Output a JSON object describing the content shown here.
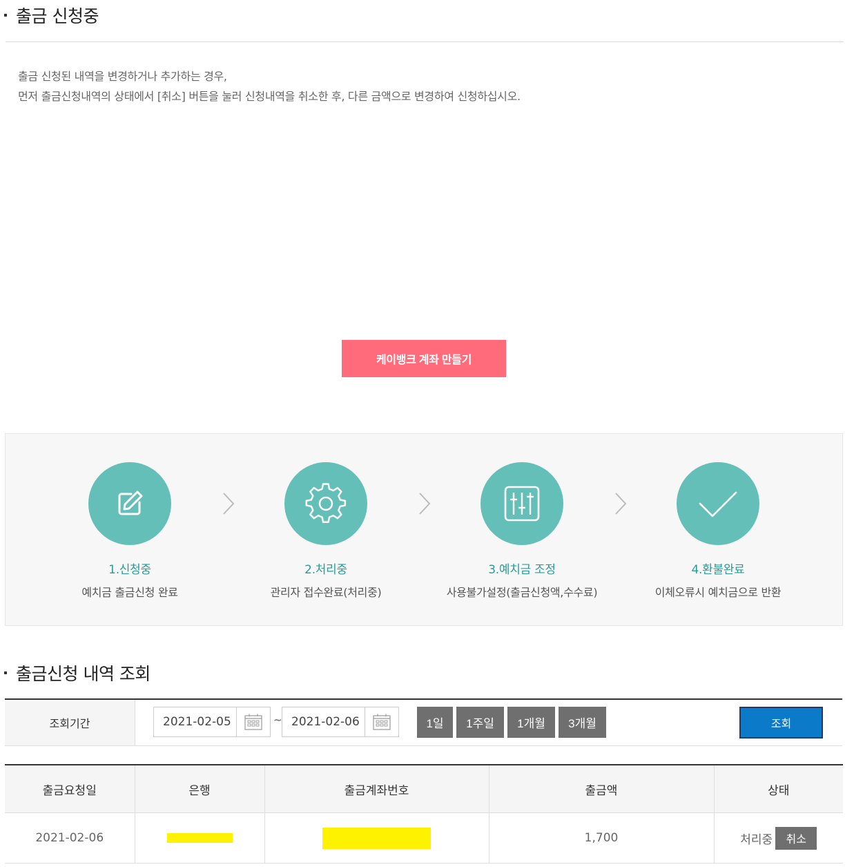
{
  "section1": {
    "title": "출금 신청중",
    "notice_line1": "출금 신청된 내역을 변경하거나 추가하는 경우,",
    "notice_line2": "먼저 출금신청내역의 상태에서 [취소] 버튼을 눌러 신청내역을 취소한 후, 다른 금액으로 변경하여 신청하십시오."
  },
  "kbank_button": {
    "label": "케이뱅크 계좌 만들기",
    "color": "#ff6b7a"
  },
  "steps": [
    {
      "title": "1.신청중",
      "desc": "예치금 출금신청 완료",
      "icon": "edit-icon"
    },
    {
      "title": "2.처리중",
      "desc": "관리자 접수완료(처리중)",
      "icon": "gear-icon"
    },
    {
      "title": "3.예치금 조정",
      "desc": "사용불가설정(출금신청액,수수료)",
      "icon": "sliders-icon"
    },
    {
      "title": "4.환불완료",
      "desc": "이체오류시 예치금으로 반환",
      "icon": "check-icon"
    }
  ],
  "step_color": "#65bfb9",
  "section2": {
    "title": "출금신청 내역 조회"
  },
  "search": {
    "label": "조회기간",
    "start_date": "2021-02-05",
    "end_date": "2021-02-06",
    "separator": "~",
    "periods": [
      "1일",
      "1주일",
      "1개월",
      "3개월"
    ],
    "search_button": "조회",
    "accent": "#0a7ac9"
  },
  "table": {
    "headers": [
      "출금요청일",
      "은행",
      "출금계좌번호",
      "출금액",
      "상태"
    ],
    "rows": [
      {
        "date": "2021-02-06",
        "amount": "1,700",
        "status": "처리중",
        "cancel": "취소"
      }
    ]
  }
}
